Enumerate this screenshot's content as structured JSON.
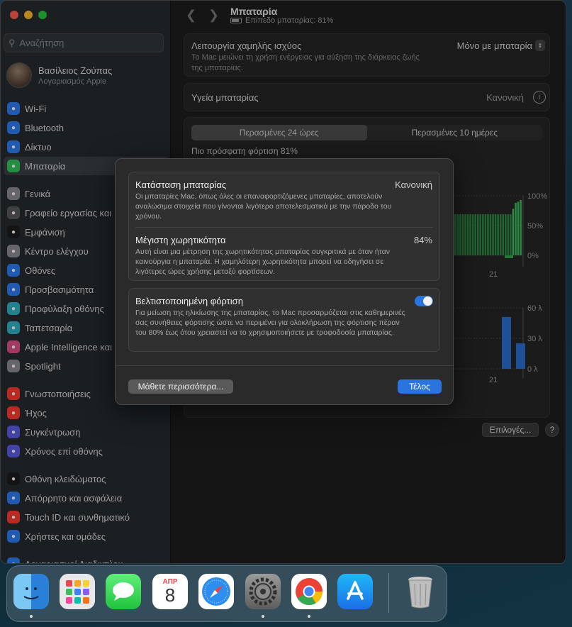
{
  "sidebar": {
    "search_placeholder": "Αναζήτηση",
    "account_name": "Βασίλειος Ζούπας",
    "account_sub": "Λογαριασμός Apple",
    "items": [
      {
        "label": "Wi-Fi",
        "icon": "wifi-icon",
        "color": "#2f7ff6"
      },
      {
        "label": "Bluetooth",
        "icon": "bluetooth-icon",
        "color": "#2f7ff6"
      },
      {
        "label": "Δίκτυο",
        "icon": "globe-icon",
        "color": "#2f7ff6"
      },
      {
        "label": "Μπαταρία",
        "icon": "battery-icon",
        "color": "#33c759"
      },
      {
        "label": "Γενικά",
        "icon": "gear-icon",
        "color": "#8e8e93"
      },
      {
        "label": "Γραφείο εργασίας και",
        "icon": "desktop-icon",
        "color": "#5a5a5f"
      },
      {
        "label": "Εμφάνιση",
        "icon": "appearance-icon",
        "color": "#1c1c1e"
      },
      {
        "label": "Κέντρο ελέγχου",
        "icon": "control-center-icon",
        "color": "#8e8e93"
      },
      {
        "label": "Οθόνες",
        "icon": "displays-icon",
        "color": "#2f7ff6"
      },
      {
        "label": "Προσβασιμότητα",
        "icon": "accessibility-icon",
        "color": "#2f7ff6"
      },
      {
        "label": "Προφύλαξη οθόνης",
        "icon": "screensaver-icon",
        "color": "#33b3c7"
      },
      {
        "label": "Ταπετσαρία",
        "icon": "wallpaper-icon",
        "color": "#33b3c7"
      },
      {
        "label": "Apple Intelligence και",
        "icon": "apple-intelligence-icon",
        "color": "#e0508a"
      },
      {
        "label": "Spotlight",
        "icon": "spotlight-icon",
        "color": "#8e8e93"
      },
      {
        "label": "Γνωστοποιήσεις",
        "icon": "notifications-icon",
        "color": "#ff3b30"
      },
      {
        "label": "Ήχος",
        "icon": "sound-icon",
        "color": "#ff3b30"
      },
      {
        "label": "Συγκέντρωση",
        "icon": "focus-icon",
        "color": "#5e5ce6"
      },
      {
        "label": "Χρόνος επί οθόνης",
        "icon": "screen-time-icon",
        "color": "#5e5ce6"
      },
      {
        "label": "Οθόνη κλειδώματος",
        "icon": "lock-screen-icon",
        "color": "#1c1c1e"
      },
      {
        "label": "Απόρρητο και ασφάλεια",
        "icon": "privacy-icon",
        "color": "#2f7ff6"
      },
      {
        "label": "Touch ID και συνθηματικό",
        "icon": "touch-id-icon",
        "color": "#ff3b30"
      },
      {
        "label": "Χρήστες και ομάδες",
        "icon": "users-icon",
        "color": "#2f7ff6"
      },
      {
        "label": "Λογαριασμοί Διαδικτύου",
        "icon": "internet-accounts-icon",
        "color": "#2f7ff6"
      }
    ]
  },
  "header": {
    "title": "Μπαταρία",
    "subtitle": "Επίπεδο μπαταρίας: 81%"
  },
  "main": {
    "low_power_label": "Λειτουργία χαμηλής ισχύος",
    "low_power_value": "Μόνο με μπαταρία",
    "low_power_desc": "Το Mac μειώνει τη χρήση ενέργειας για αύξηση της διάρκειας ζωής της μπαταρίας.",
    "health_label": "Υγεία μπαταρίας",
    "health_value": "Κανονική",
    "tab_24h": "Περασμένες 24 ώρες",
    "tab_10d": "Περασμένες 10 ημέρες",
    "last_charge": "Πιο πρόσφατη φόρτιση 81%",
    "chart1_ticks": [
      "100%",
      "50%",
      "0%"
    ],
    "chart1_x": "21",
    "chart2_ticks": [
      "60 λ",
      "30 λ",
      "0 λ"
    ],
    "chart2_x": "21",
    "options_button": "Επιλογές...",
    "help_button": "?"
  },
  "chart_data": [
    {
      "type": "bar",
      "title": "",
      "ylabel": "",
      "ylim": [
        0,
        100
      ],
      "series": [
        {
          "values": [
            69,
            69,
            69,
            69,
            69,
            69,
            69,
            69,
            69,
            69,
            69,
            69,
            69,
            69,
            69,
            69,
            69,
            69,
            69,
            69,
            69,
            69,
            69,
            78,
            88,
            90,
            93
          ]
        }
      ]
    },
    {
      "type": "bar",
      "title": "",
      "ylabel": "",
      "ylim": [
        0,
        60
      ],
      "series": [
        {
          "values": [
            51,
            25
          ]
        }
      ]
    }
  ],
  "sheet": {
    "status_label": "Κατάσταση μπαταρίας",
    "status_value": "Κανονική",
    "status_desc": "Οι μπαταρίες Mac, όπως όλες οι επαναφορτιζόμενες μπαταρίες, αποτελούν αναλώσιμα στοιχεία που γίνονται λιγότερο αποτελεσματικά με την πάροδο του χρόνου.",
    "capacity_label": "Μέγιστη χωρητικότητα",
    "capacity_value": "84%",
    "capacity_desc": "Αυτή είναι μια μέτρηση της χωρητικότητας μπαταρίας συγκριτικά με όταν ήταν καινούργια η μπαταρία. Η χαμηλότερη χωρητικότητα μπορεί να οδηγήσει σε λιγότερες ώρες χρήσης μεταξύ φορτίσεων.",
    "optimized_label": "Βελτιστοποιημένη φόρτιση",
    "optimized_desc": "Για μείωση της ηλικίωσης της μπαταρίας, το Mac προσαρμόζεται στις καθημερινές σας συνήθειες φόρτισης ώστε να περιμένει για ολοκλήρωση της φόρτισης πέραν του 80% έως ότου χρειαστεί να το χρησιμοποιήσετε με τροφοδοσία μπαταρίας.",
    "learn_more": "Μάθετε περισσότερα...",
    "done": "Τέλος"
  },
  "dock": {
    "apps": [
      "Finder",
      "Launchpad",
      "Messages",
      "Calendar",
      "Safari",
      "System Settings",
      "Chrome",
      "App Store",
      "Trash"
    ],
    "calendar_month": "ΑΠΡ",
    "calendar_day": "8"
  },
  "colors": {
    "accent": "#2a74e0",
    "green": "#2ea84a",
    "blue": "#2b6fd1"
  }
}
